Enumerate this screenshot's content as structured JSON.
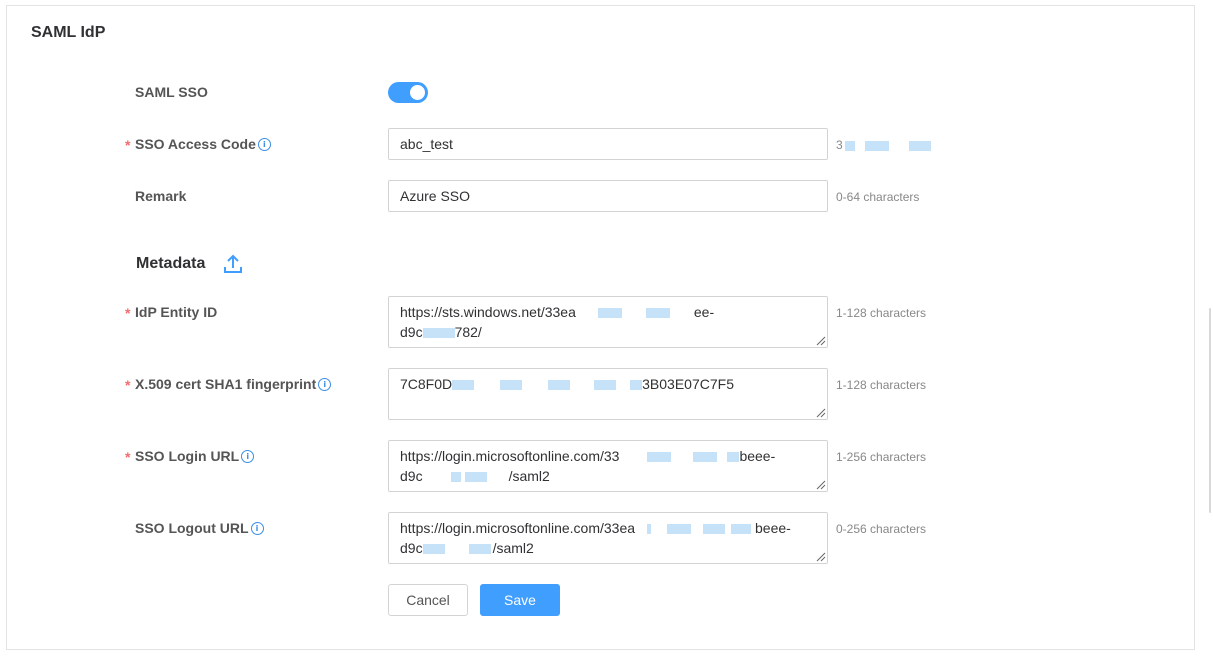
{
  "page": {
    "title": "SAML IdP"
  },
  "saml_sso": {
    "label": "SAML SSO",
    "enabled": true
  },
  "sso_access_code": {
    "label": "SSO Access Code",
    "value": "abc_test",
    "hint": "3"
  },
  "remark": {
    "label": "Remark",
    "value": "Azure SSO",
    "hint": "0-64 characters"
  },
  "metadata": {
    "title": "Metadata",
    "icon": "upload-icon"
  },
  "idp_entity_id": {
    "label": "IdP Entity ID",
    "line1": "https://sts.windows.net/33ea",
    "line1_end": "ee-",
    "line2": "d9c",
    "line2_end": "782/",
    "hint": "1-128 characters"
  },
  "x509_fingerprint": {
    "label": "X.509 cert SHA1 fingerprint",
    "start": "7C8F0D",
    "end": "3B03E07C7F5",
    "hint": "1-128 characters"
  },
  "sso_login_url": {
    "label": "SSO Login URL",
    "line1": "https://login.microsoftonline.com/33",
    "line1_end": "beee-",
    "line2": "d9c",
    "line2_end": "/saml2",
    "hint": "1-256 characters"
  },
  "sso_logout_url": {
    "label": "SSO Logout URL",
    "line1": "https://login.microsoftonline.com/33ea",
    "line1_end": "beee-",
    "line2": "d9c",
    "line2_end": "/saml2",
    "hint": "0-256 characters"
  },
  "actions": {
    "cancel": "Cancel",
    "save": "Save"
  },
  "colors": {
    "accent": "#409eff",
    "required": "#f56c6c"
  }
}
